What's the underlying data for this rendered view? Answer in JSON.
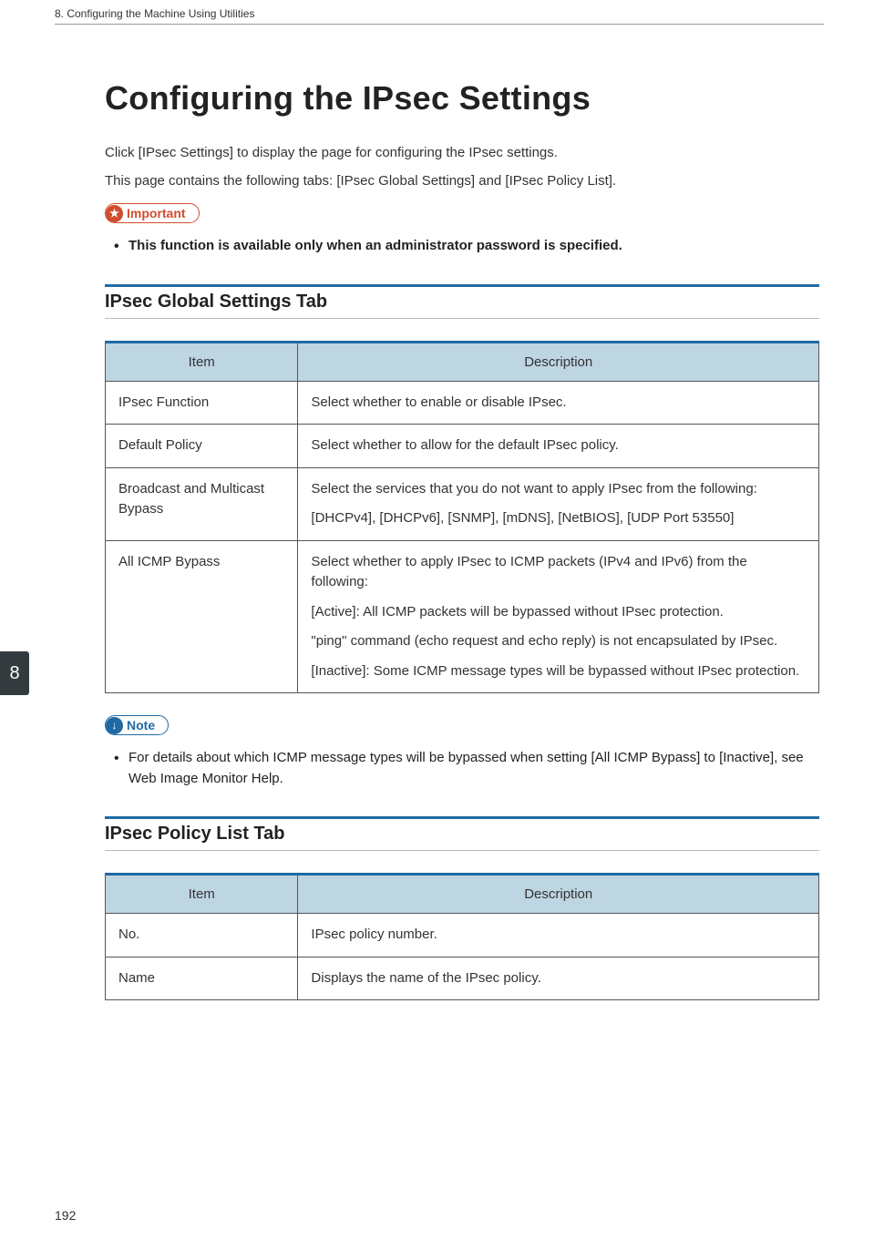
{
  "header": {
    "chapter": "8. Configuring the Machine Using Utilities"
  },
  "side_tab": "8",
  "page_number": "192",
  "title": "Configuring the IPsec Settings",
  "intro": {
    "p1": "Click [IPsec Settings] to display the page for configuring the IPsec settings.",
    "p2": "This page contains the following tabs: [IPsec Global Settings] and [IPsec Policy List]."
  },
  "callouts": {
    "important_label": "Important",
    "important_item": "This function is available only when an administrator password is specified.",
    "note_label": "Note",
    "note_item": "For details about which ICMP message types will be bypassed when setting [All ICMP Bypass] to [Inactive], see Web Image Monitor Help."
  },
  "sections": {
    "global": {
      "heading": "IPsec Global Settings Tab",
      "columns": {
        "item": "Item",
        "desc": "Description"
      },
      "rows": [
        {
          "item": "IPsec Function",
          "desc": "Select whether to enable or disable IPsec."
        },
        {
          "item": "Default Policy",
          "desc": "Select whether to allow for the default IPsec policy."
        },
        {
          "item": "Broadcast and Multicast Bypass",
          "desc_lines": [
            "Select the services that you do not want to apply IPsec from the following:",
            "[DHCPv4], [DHCPv6], [SNMP], [mDNS], [NetBIOS], [UDP Port 53550]"
          ]
        },
        {
          "item": "All ICMP Bypass",
          "desc_lines": [
            "Select whether to apply IPsec to ICMP packets (IPv4 and IPv6) from the following:",
            "[Active]: All ICMP packets will be bypassed without IPsec protection.",
            "\"ping\" command (echo request and echo reply) is not encapsulated by IPsec.",
            "[Inactive]: Some ICMP message types will be bypassed without IPsec protection."
          ]
        }
      ]
    },
    "policy": {
      "heading": "IPsec Policy List Tab",
      "columns": {
        "item": "Item",
        "desc": "Description"
      },
      "rows": [
        {
          "item": "No.",
          "desc": "IPsec policy number."
        },
        {
          "item": "Name",
          "desc": "Displays the name of the IPsec policy."
        }
      ]
    }
  }
}
